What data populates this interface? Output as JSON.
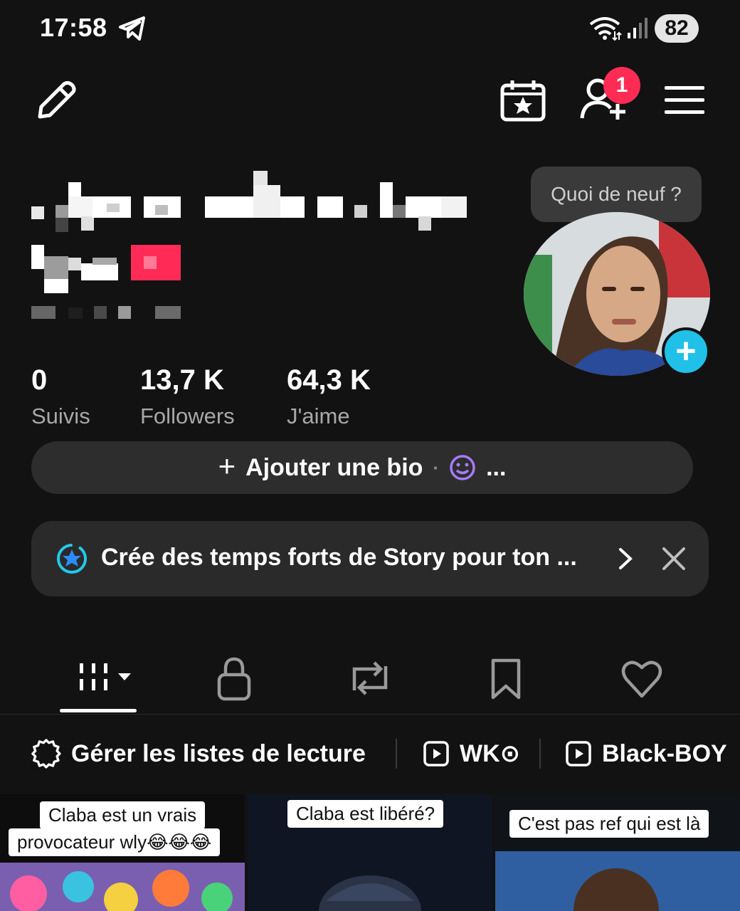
{
  "status_bar": {
    "time": "17:58",
    "battery": "82"
  },
  "notifications": {
    "friend_requests": "1"
  },
  "profile": {
    "tooltip": "Quoi de neuf ?",
    "stats": [
      {
        "value": "0",
        "label": "Suivis"
      },
      {
        "value": "13,7 K",
        "label": "Followers"
      },
      {
        "value": "64,3 K",
        "label": "J'aime"
      }
    ],
    "bio_button": {
      "plus": "+",
      "label": "Ajouter une bio",
      "dot": "·",
      "more": "..."
    }
  },
  "story_banner": {
    "text": "Crée des temps forts de Story pour ton ..."
  },
  "tabs": [
    "videos-grid",
    "private",
    "reposts",
    "favorites",
    "liked"
  ],
  "playlists": {
    "manage_label": "Gérer les listes de lecture",
    "items": [
      "WK⊙",
      "Black-BOY"
    ]
  },
  "videos": [
    {
      "caption_lines": [
        "Claba est un vrais",
        "provocateur wly😂😂😂"
      ]
    },
    {
      "caption_lines": [
        "Claba est libéré?"
      ]
    },
    {
      "caption_lines": [
        "C'est pas ref qui est là"
      ]
    }
  ],
  "colors": {
    "accent_red": "#fe2c55",
    "accent_cyan": "#20c0e8",
    "background": "#121212"
  }
}
